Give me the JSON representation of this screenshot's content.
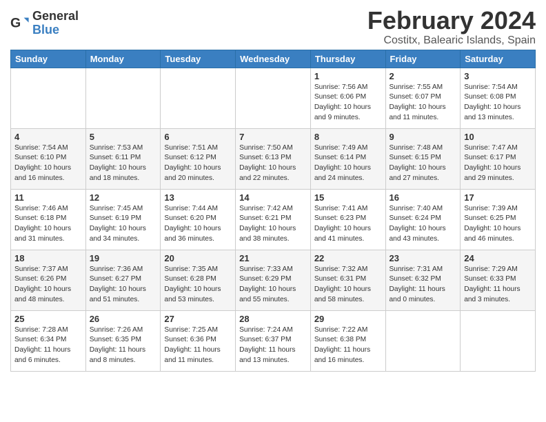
{
  "header": {
    "logo_general": "General",
    "logo_blue": "Blue",
    "title": "February 2024",
    "subtitle": "Costitx, Balearic Islands, Spain"
  },
  "days_of_week": [
    "Sunday",
    "Monday",
    "Tuesday",
    "Wednesday",
    "Thursday",
    "Friday",
    "Saturday"
  ],
  "weeks": [
    [
      {
        "day": "",
        "info": ""
      },
      {
        "day": "",
        "info": ""
      },
      {
        "day": "",
        "info": ""
      },
      {
        "day": "",
        "info": ""
      },
      {
        "day": "1",
        "info": "Sunrise: 7:56 AM\nSunset: 6:06 PM\nDaylight: 10 hours\nand 9 minutes."
      },
      {
        "day": "2",
        "info": "Sunrise: 7:55 AM\nSunset: 6:07 PM\nDaylight: 10 hours\nand 11 minutes."
      },
      {
        "day": "3",
        "info": "Sunrise: 7:54 AM\nSunset: 6:08 PM\nDaylight: 10 hours\nand 13 minutes."
      }
    ],
    [
      {
        "day": "4",
        "info": "Sunrise: 7:54 AM\nSunset: 6:10 PM\nDaylight: 10 hours\nand 16 minutes."
      },
      {
        "day": "5",
        "info": "Sunrise: 7:53 AM\nSunset: 6:11 PM\nDaylight: 10 hours\nand 18 minutes."
      },
      {
        "day": "6",
        "info": "Sunrise: 7:51 AM\nSunset: 6:12 PM\nDaylight: 10 hours\nand 20 minutes."
      },
      {
        "day": "7",
        "info": "Sunrise: 7:50 AM\nSunset: 6:13 PM\nDaylight: 10 hours\nand 22 minutes."
      },
      {
        "day": "8",
        "info": "Sunrise: 7:49 AM\nSunset: 6:14 PM\nDaylight: 10 hours\nand 24 minutes."
      },
      {
        "day": "9",
        "info": "Sunrise: 7:48 AM\nSunset: 6:15 PM\nDaylight: 10 hours\nand 27 minutes."
      },
      {
        "day": "10",
        "info": "Sunrise: 7:47 AM\nSunset: 6:17 PM\nDaylight: 10 hours\nand 29 minutes."
      }
    ],
    [
      {
        "day": "11",
        "info": "Sunrise: 7:46 AM\nSunset: 6:18 PM\nDaylight: 10 hours\nand 31 minutes."
      },
      {
        "day": "12",
        "info": "Sunrise: 7:45 AM\nSunset: 6:19 PM\nDaylight: 10 hours\nand 34 minutes."
      },
      {
        "day": "13",
        "info": "Sunrise: 7:44 AM\nSunset: 6:20 PM\nDaylight: 10 hours\nand 36 minutes."
      },
      {
        "day": "14",
        "info": "Sunrise: 7:42 AM\nSunset: 6:21 PM\nDaylight: 10 hours\nand 38 minutes."
      },
      {
        "day": "15",
        "info": "Sunrise: 7:41 AM\nSunset: 6:23 PM\nDaylight: 10 hours\nand 41 minutes."
      },
      {
        "day": "16",
        "info": "Sunrise: 7:40 AM\nSunset: 6:24 PM\nDaylight: 10 hours\nand 43 minutes."
      },
      {
        "day": "17",
        "info": "Sunrise: 7:39 AM\nSunset: 6:25 PM\nDaylight: 10 hours\nand 46 minutes."
      }
    ],
    [
      {
        "day": "18",
        "info": "Sunrise: 7:37 AM\nSunset: 6:26 PM\nDaylight: 10 hours\nand 48 minutes."
      },
      {
        "day": "19",
        "info": "Sunrise: 7:36 AM\nSunset: 6:27 PM\nDaylight: 10 hours\nand 51 minutes."
      },
      {
        "day": "20",
        "info": "Sunrise: 7:35 AM\nSunset: 6:28 PM\nDaylight: 10 hours\nand 53 minutes."
      },
      {
        "day": "21",
        "info": "Sunrise: 7:33 AM\nSunset: 6:29 PM\nDaylight: 10 hours\nand 55 minutes."
      },
      {
        "day": "22",
        "info": "Sunrise: 7:32 AM\nSunset: 6:31 PM\nDaylight: 10 hours\nand 58 minutes."
      },
      {
        "day": "23",
        "info": "Sunrise: 7:31 AM\nSunset: 6:32 PM\nDaylight: 11 hours\nand 0 minutes."
      },
      {
        "day": "24",
        "info": "Sunrise: 7:29 AM\nSunset: 6:33 PM\nDaylight: 11 hours\nand 3 minutes."
      }
    ],
    [
      {
        "day": "25",
        "info": "Sunrise: 7:28 AM\nSunset: 6:34 PM\nDaylight: 11 hours\nand 6 minutes."
      },
      {
        "day": "26",
        "info": "Sunrise: 7:26 AM\nSunset: 6:35 PM\nDaylight: 11 hours\nand 8 minutes."
      },
      {
        "day": "27",
        "info": "Sunrise: 7:25 AM\nSunset: 6:36 PM\nDaylight: 11 hours\nand 11 minutes."
      },
      {
        "day": "28",
        "info": "Sunrise: 7:24 AM\nSunset: 6:37 PM\nDaylight: 11 hours\nand 13 minutes."
      },
      {
        "day": "29",
        "info": "Sunrise: 7:22 AM\nSunset: 6:38 PM\nDaylight: 11 hours\nand 16 minutes."
      },
      {
        "day": "",
        "info": ""
      },
      {
        "day": "",
        "info": ""
      }
    ]
  ]
}
